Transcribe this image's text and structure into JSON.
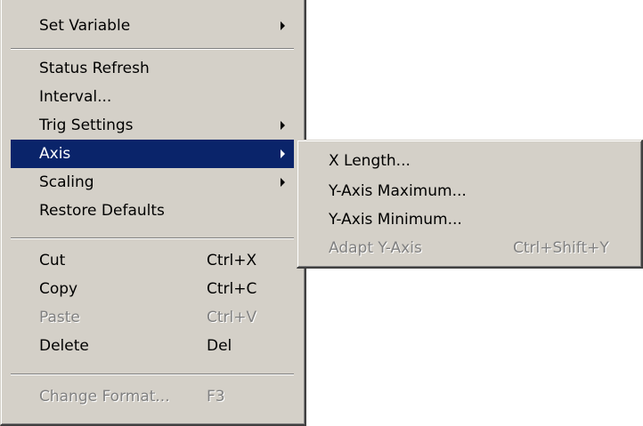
{
  "context_menu": {
    "items": [
      {
        "label": "Set Variable",
        "submenu": true
      },
      {
        "label": "Status Refresh"
      },
      {
        "label": "Interval..."
      },
      {
        "label": "Trig Settings",
        "submenu": true
      },
      {
        "label": "Axis",
        "submenu": true,
        "selected": true
      },
      {
        "label": "Scaling",
        "submenu": true
      },
      {
        "label": "Restore Defaults"
      },
      {
        "label": "Cut",
        "shortcut": "Ctrl+X"
      },
      {
        "label": "Copy",
        "shortcut": "Ctrl+C"
      },
      {
        "label": "Paste",
        "shortcut": "Ctrl+V",
        "disabled": true
      },
      {
        "label": "Delete",
        "shortcut": "Del"
      },
      {
        "label": "Change Format...",
        "shortcut": "F3",
        "disabled": true
      }
    ]
  },
  "axis_submenu": {
    "items": [
      {
        "label": "X Length..."
      },
      {
        "label": "Y-Axis Maximum..."
      },
      {
        "label": "Y-Axis Minimum..."
      },
      {
        "label": "Adapt Y-Axis",
        "shortcut": "Ctrl+Shift+Y",
        "disabled": true
      }
    ]
  },
  "colors": {
    "menu_background": "#d4d0c8",
    "selection_highlight": "#0a246a",
    "disabled_text": "#808080"
  }
}
